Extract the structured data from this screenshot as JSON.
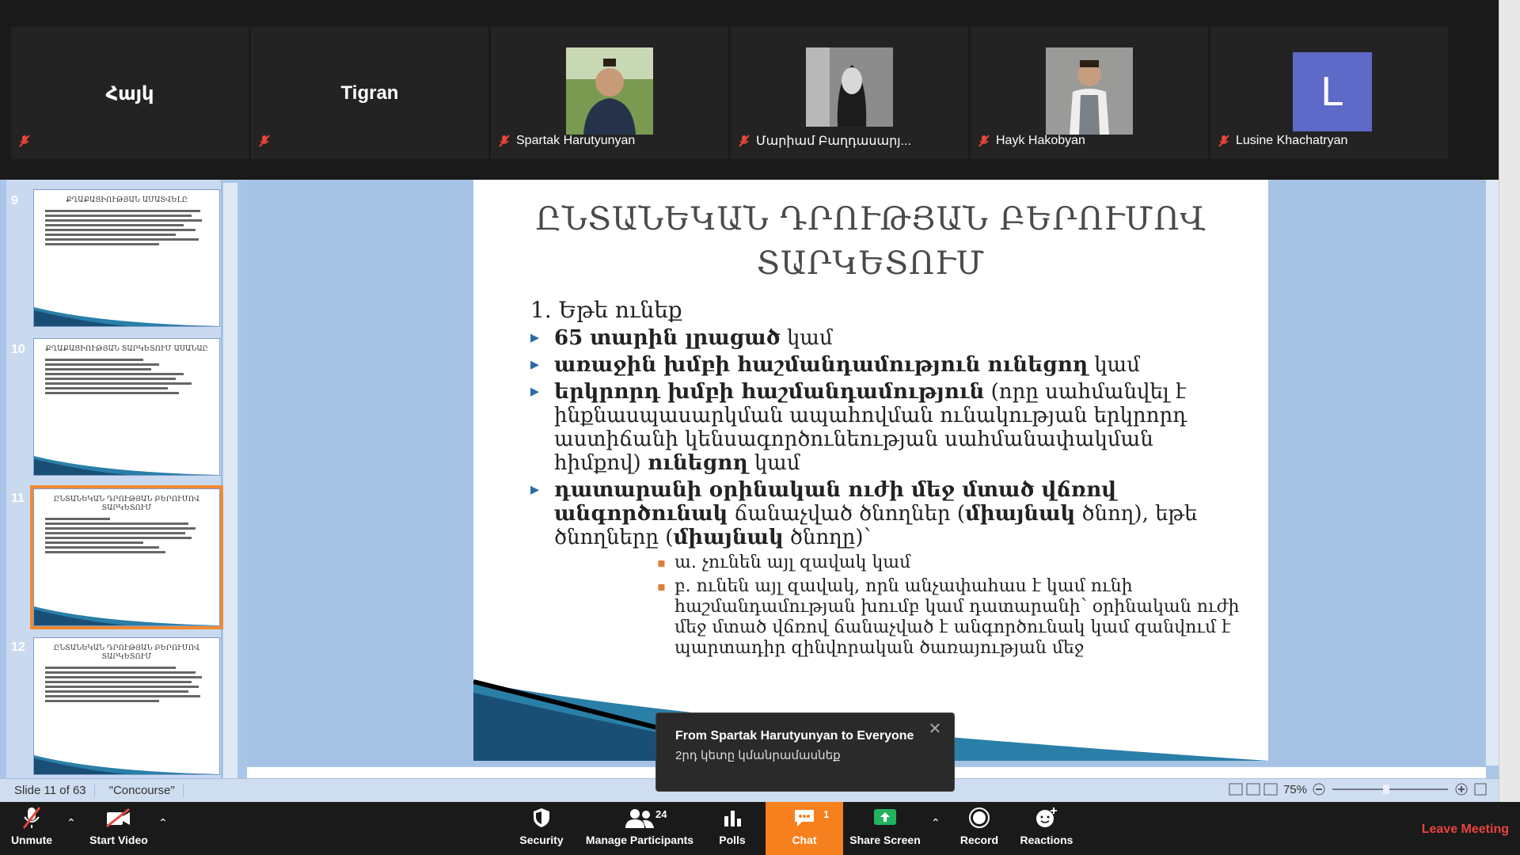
{
  "participants": [
    {
      "name": "Հայկ",
      "display": "initials"
    },
    {
      "name": "Tigran",
      "display": "initials"
    },
    {
      "name": "Spartak Harutyunyan",
      "display": "photo"
    },
    {
      "name": "Մարիամ Բաղդասարյ...",
      "display": "photo"
    },
    {
      "name": "Hayk Hakobyan",
      "display": "photo"
    },
    {
      "name": "Lusine Khachatryan",
      "display": "avatar",
      "avatar_letter": "L",
      "avatar_color": "#5d6ac7"
    }
  ],
  "thumbnails": [
    {
      "number": "9",
      "title": "ՔՂԱՔԱՑԻՈՒԹՅԱՆ ԱՄԱՏՎԵԼԸ"
    },
    {
      "number": "10",
      "title": "ՔՂԱՔԱՑԻՈՒԹՅԱՆ ՏԱՐԿԵՏՈՒՄ ԱՍԱՆԱԸ"
    },
    {
      "number": "11",
      "title": "ԸՆՏԱՆԵԿԱՆ ԴՐՈՒԹՅԱՆ ԲԵՐՈՒՄՈՎ ՏԱՐԿԵՏՈՒՄ",
      "selected": true
    },
    {
      "number": "12",
      "title": "ԸՆՏԱՆԵԿԱՆ ԴՐՈՒԹՅԱՆ ԲԵՐՈՒՄՈՎ ՏԱՐԿԵՏՈՒՄ"
    }
  ],
  "slide": {
    "title_line1": "ԸՆՏԱՆԵԿԱՆ ԴՐՈՒԹՅԱՆ ԲԵՐՈՒՄՈՎ",
    "title_line2": "ՏԱՐԿԵՏՈՒՄ",
    "numbered_item": "1. Եթե ունեք",
    "b1_bold": "65 տարին լրացած",
    "b1_rest": " կամ",
    "b2_bold": "առաջին խմբի հաշմանդամություն ունեցող",
    "b2_rest": " կամ",
    "b3_bold": "երկրորդ խմբի հաշմանդամություն",
    "b3_mid": " (որը սահմանվել է ինքնասպասարկման ապահովման ունակության երկրորդ աստիճանի կենսագործունեության սահմանափակման հիմքով) ",
    "b3_bold2": "ունեցող",
    "b3_rest": " կամ",
    "b4_bold": "դատարանի օրինական ուժի մեջ մտած վճռով անգործունակ",
    "b4_mid": " ճանաչված ծնողներ (",
    "b4_bold2": "միայնակ",
    "b4_mid2": " ծնող), եթե ծնողները (",
    "b4_bold3": "միայնակ",
    "b4_rest": " ծնողը)՝",
    "sub1": "ա. չունեն այլ զավակ կամ",
    "sub2": "բ. ունեն այլ զավակ, որն անչափահաս է կամ ունի հաշմանդամության խումբ կամ դատարանի՝ օրինական ուժի մեջ մտած վճռով ճանաչված է անգործունակ կամ զանվում է պարտադիր զինվորական ծառայության մեջ"
  },
  "status": {
    "slide_info": "Slide 11 of 63",
    "theme": "\"Concourse\"",
    "zoom": "75%"
  },
  "toast": {
    "title": "From Spartak Harutyunyan to Everyone",
    "message": "2րդ կետը կմանրամասնեք",
    "close": "✕"
  },
  "toolbar": {
    "unmute": "Unmute",
    "start_video": "Start Video",
    "security": "Security",
    "manage_participants": "Manage Participants",
    "participants_count": "24",
    "polls": "Polls",
    "chat": "Chat",
    "chat_badge": "1",
    "share_screen": "Share Screen",
    "record": "Record",
    "reactions": "Reactions",
    "leave": "Leave Meeting",
    "caret": "⌃"
  }
}
